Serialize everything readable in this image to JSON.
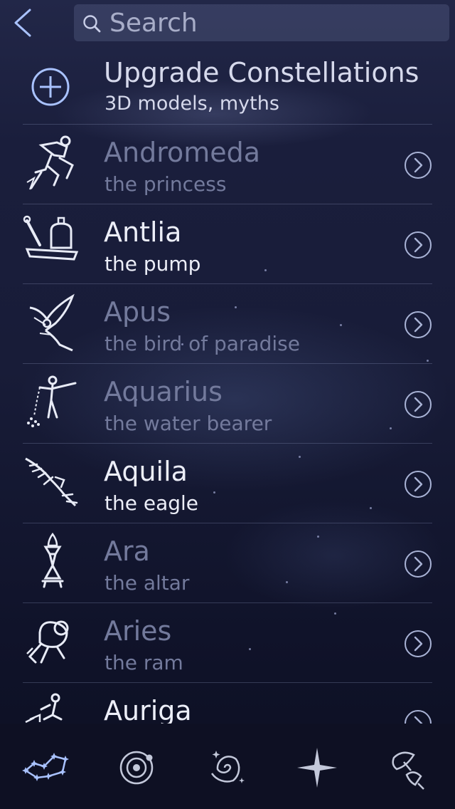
{
  "search": {
    "placeholder": "Search"
  },
  "upgrade": {
    "title": "Upgrade Constellations",
    "subtitle": "3D models, myths"
  },
  "constellations": [
    {
      "name": "Andromeda",
      "subtitle": "the princess",
      "icon": "andromeda-figure-icon",
      "dimmed": true
    },
    {
      "name": "Antlia",
      "subtitle": "the pump",
      "icon": "pump-figure-icon",
      "dimmed": false
    },
    {
      "name": "Apus",
      "subtitle": "the bird of paradise",
      "icon": "bird-of-paradise-figure-icon",
      "dimmed": true
    },
    {
      "name": "Aquarius",
      "subtitle": "the water bearer",
      "icon": "water-bearer-figure-icon",
      "dimmed": true
    },
    {
      "name": "Aquila",
      "subtitle": "the eagle",
      "icon": "eagle-figure-icon",
      "dimmed": false
    },
    {
      "name": "Ara",
      "subtitle": "the altar",
      "icon": "altar-figure-icon",
      "dimmed": true
    },
    {
      "name": "Aries",
      "subtitle": "the ram",
      "icon": "ram-figure-icon",
      "dimmed": true
    },
    {
      "name": "Auriga",
      "subtitle": "",
      "icon": "charioteer-figure-icon",
      "dimmed": false
    }
  ],
  "tabs": [
    {
      "icon": "constellations-icon",
      "selected": true
    },
    {
      "icon": "solar-system-icon",
      "selected": false
    },
    {
      "icon": "deep-sky-galaxy-icon",
      "selected": false
    },
    {
      "icon": "stars-icon",
      "selected": false
    },
    {
      "icon": "satellites-icon",
      "selected": false
    }
  ],
  "colors": {
    "background": "#181c38",
    "accent": "#a9c2ff",
    "text_bright": "#eceef8",
    "text_dim": "#737a9c",
    "tabbar": "#0e1023"
  }
}
